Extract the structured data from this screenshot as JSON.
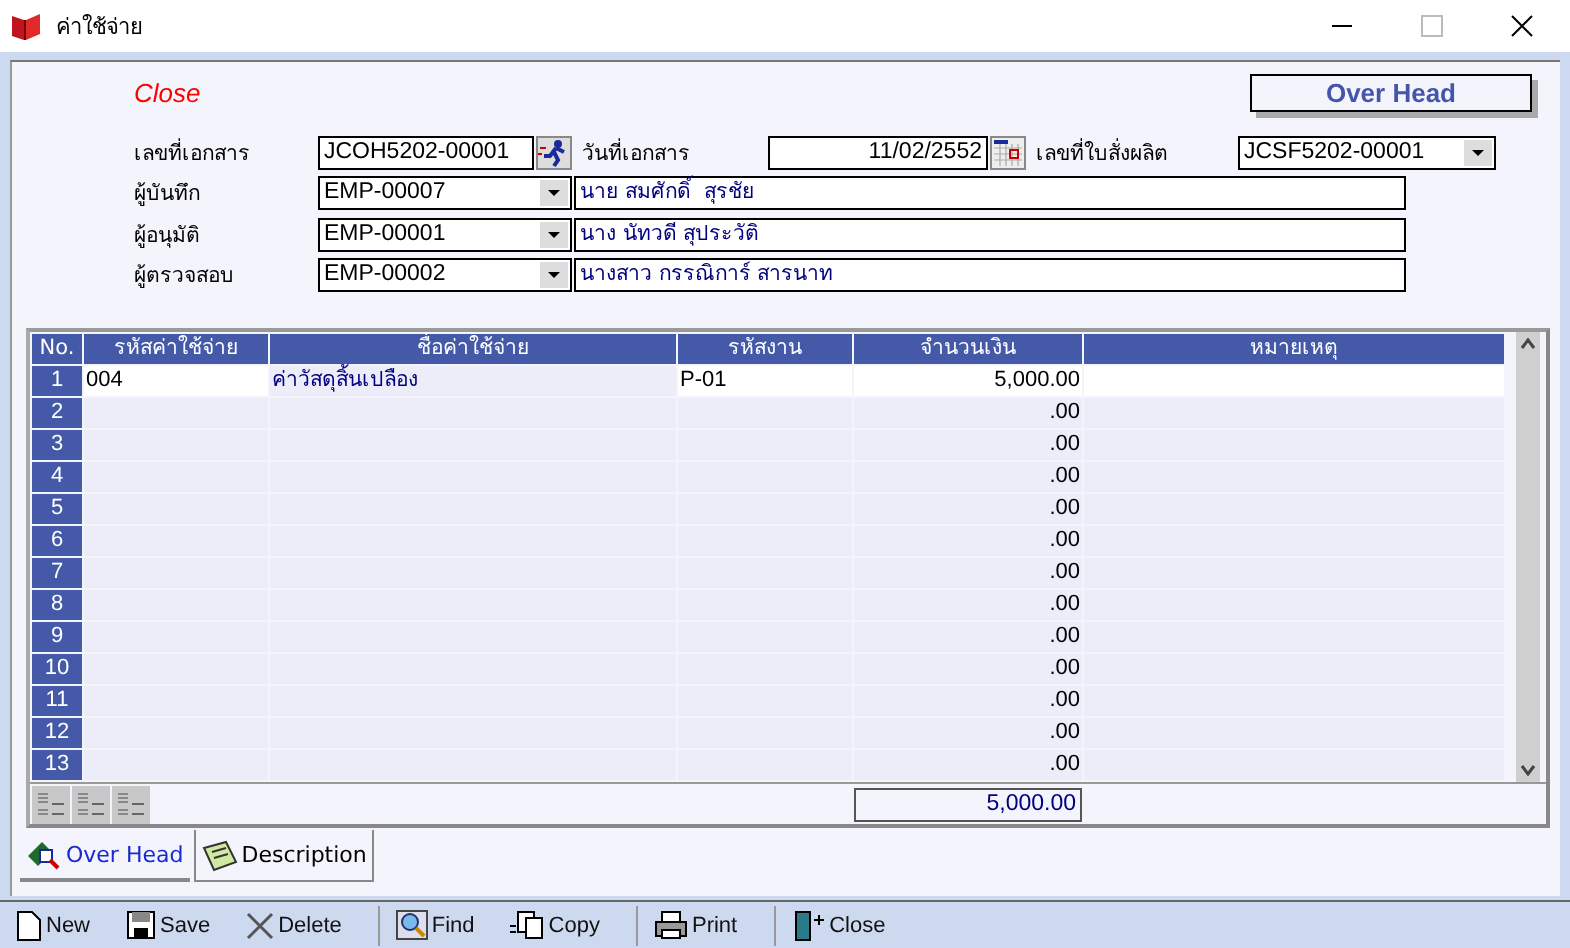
{
  "window": {
    "title": "ค่าใช้จ่าย"
  },
  "status_text": "Close",
  "overhead_button": "Over Head",
  "form": {
    "doc_no": {
      "label": "เลขที่เอกสาร",
      "value": "JCOH5202-00001"
    },
    "doc_date": {
      "label": "วันที่เอกสาร",
      "value": "11/02/2552"
    },
    "order_no": {
      "label": "เลขที่ใบสั่งผลิต",
      "value": "JCSF5202-00001"
    },
    "people": [
      {
        "label": "ผู้บันทึก",
        "code": "EMP-00007",
        "name": "นาย สมศักดิ์  สุรชัย"
      },
      {
        "label": "ผู้อนุมัติ",
        "code": "EMP-00001",
        "name": "นาง นัทวดี สุประวัติ"
      },
      {
        "label": "ผู้ตรวจสอบ",
        "code": "EMP-00002",
        "name": "นางสาว กรรณิการ์ สารนาท"
      }
    ]
  },
  "table": {
    "columns": [
      "No.",
      "รหัสค่าใช้จ่าย",
      "ชื่อค่าใช้จ่าย",
      "รหัสงาน",
      "จำนวนเงิน",
      "หมายเหตุ"
    ],
    "rows": [
      {
        "no": "1",
        "code": "004",
        "name": "ค่าวัสดุสิ้นเปลือง",
        "job": "P-01",
        "amount": "5,000.00",
        "selected": true
      },
      {
        "no": "2",
        "amount": ".00",
        "selected": false
      },
      {
        "no": "3",
        "amount": ".00",
        "selected": false
      },
      {
        "no": "4",
        "amount": ".00",
        "selected": false
      },
      {
        "no": "5",
        "amount": ".00",
        "selected": false
      },
      {
        "no": "6",
        "amount": ".00",
        "selected": false
      },
      {
        "no": "7",
        "amount": ".00",
        "selected": false
      },
      {
        "no": "8",
        "amount": ".00",
        "selected": false
      },
      {
        "no": "9",
        "amount": ".00",
        "selected": false
      },
      {
        "no": "10",
        "amount": ".00",
        "selected": false
      },
      {
        "no": "11",
        "amount": ".00",
        "selected": false
      },
      {
        "no": "12",
        "amount": ".00",
        "selected": false
      },
      {
        "no": "13",
        "amount": ".00",
        "selected": false
      }
    ],
    "total": "5,000.00"
  },
  "tabs": [
    {
      "label": "Over Head",
      "selected": true
    },
    {
      "label": "Description",
      "selected": false
    }
  ],
  "toolbar": [
    {
      "kind": "new",
      "label": "New"
    },
    {
      "kind": "save",
      "label": "Save"
    },
    {
      "kind": "delete",
      "label": "Delete"
    },
    {
      "kind": "find",
      "label": "Find"
    },
    {
      "kind": "copy",
      "label": "Copy"
    },
    {
      "kind": "print",
      "label": "Print"
    },
    {
      "kind": "close",
      "label": "Close"
    }
  ]
}
